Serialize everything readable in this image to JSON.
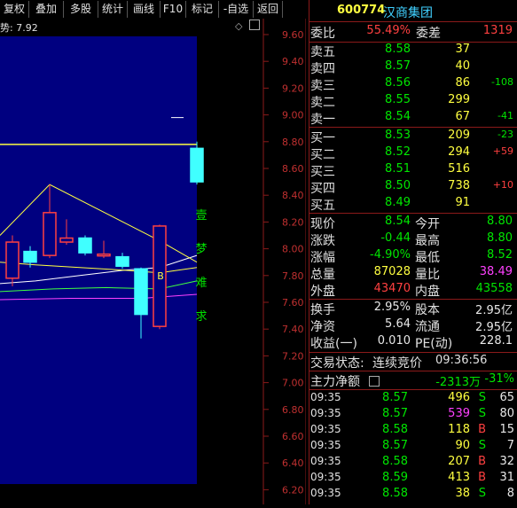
{
  "toolbar": {
    "buttons": [
      "复权",
      "叠加",
      "多股",
      "统计",
      "画线",
      "F10",
      "标记",
      "-自选",
      "返回"
    ]
  },
  "chart": {
    "indicator_text": "势: 7.92",
    "y_ticks": [
      "9.60",
      "9.40",
      "9.20",
      "9.00",
      "8.80",
      "8.60",
      "8.40",
      "8.20",
      "8.00",
      "7.80",
      "7.60",
      "7.40",
      "7.20",
      "7.00",
      "6.80",
      "6.60",
      "6.40",
      "6.20"
    ],
    "vertical_text": [
      "壹",
      "梦",
      "难",
      "求"
    ],
    "b_marker": "B",
    "candles": [
      {
        "open": 7.78,
        "close": 8.05,
        "high": 8.1,
        "low": 7.72,
        "color": "red"
      },
      {
        "open": 7.98,
        "close": 7.9,
        "high": 8.02,
        "low": 7.86,
        "color": "cyan"
      },
      {
        "open": 7.95,
        "close": 8.27,
        "high": 8.48,
        "low": 7.93,
        "color": "red"
      },
      {
        "open": 8.08,
        "close": 8.05,
        "high": 8.22,
        "low": 8.03,
        "color": "red"
      },
      {
        "open": 8.08,
        "close": 7.97,
        "high": 8.1,
        "low": 7.95,
        "color": "cyan"
      },
      {
        "open": 7.96,
        "close": 7.95,
        "high": 8.06,
        "low": 7.93,
        "color": "red"
      },
      {
        "open": 7.94,
        "close": 7.87,
        "high": 7.97,
        "low": 7.85,
        "color": "cyan"
      },
      {
        "open": 7.85,
        "close": 7.51,
        "high": 7.86,
        "low": 7.33,
        "color": "cyan"
      },
      {
        "open": 7.42,
        "close": 8.17,
        "high": 8.18,
        "low": 7.4,
        "color": "red"
      },
      {
        "open": 8.75,
        "close": 8.5,
        "high": 8.8,
        "low": 8.48,
        "color": "cyan"
      }
    ]
  },
  "quote": {
    "code": "600774",
    "name": "汉商集团",
    "weibi_label": "委比",
    "weibi_value": "55.49%",
    "weicha_label": "委差",
    "weicha_value": "1319",
    "sell": [
      {
        "label": "卖五",
        "price": "8.58",
        "vol": "37",
        "chg": ""
      },
      {
        "label": "卖四",
        "price": "8.57",
        "vol": "40",
        "chg": ""
      },
      {
        "label": "卖三",
        "price": "8.56",
        "vol": "86",
        "chg": "-108"
      },
      {
        "label": "卖二",
        "price": "8.55",
        "vol": "299",
        "chg": ""
      },
      {
        "label": "卖一",
        "price": "8.54",
        "vol": "67",
        "chg": "-41"
      }
    ],
    "buy": [
      {
        "label": "买一",
        "price": "8.53",
        "vol": "209",
        "chg": "-23"
      },
      {
        "label": "买二",
        "price": "8.52",
        "vol": "294",
        "chg": "+59"
      },
      {
        "label": "买三",
        "price": "8.51",
        "vol": "516",
        "chg": ""
      },
      {
        "label": "买四",
        "price": "8.50",
        "vol": "738",
        "chg": "+10"
      },
      {
        "label": "买五",
        "price": "8.49",
        "vol": "91",
        "chg": ""
      }
    ],
    "stats": [
      {
        "l1": "现价",
        "v1": "8.54",
        "l2": "今开",
        "v2": "8.80"
      },
      {
        "l1": "涨跌",
        "v1": "-0.44",
        "l2": "最高",
        "v2": "8.80"
      },
      {
        "l1": "涨幅",
        "v1": "-4.90%",
        "l2": "最低",
        "v2": "8.52"
      },
      {
        "l1": "总量",
        "v1": "87028",
        "l2": "量比",
        "v2": "38.49"
      },
      {
        "l1": "外盘",
        "v1": "43470",
        "l2": "内盘",
        "v2": "43558"
      }
    ],
    "stats2": [
      {
        "l1": "换手",
        "v1": "2.95%",
        "l2": "股本",
        "v2": "2.95亿"
      },
      {
        "l1": "净资",
        "v1": "5.64",
        "l2": "流通",
        "v2": "2.95亿"
      },
      {
        "l1": "收益(一)",
        "v1": "0.010",
        "l2": "PE(动)",
        "v2": "228.1"
      }
    ],
    "trade_status_label": "交易状态:",
    "trade_status_value": "连续竞价",
    "trade_status_time": "09:36:56",
    "main_net_label": "主力净额",
    "main_net_value": "-2313万",
    "main_net_pct": "-31%",
    "ticks": [
      {
        "time": "09:35",
        "price": "8.57",
        "vol": "496",
        "bs": "S",
        "n": "65"
      },
      {
        "time": "09:35",
        "price": "8.57",
        "vol": "539",
        "bs": "S",
        "n": "80"
      },
      {
        "time": "09:35",
        "price": "8.58",
        "vol": "118",
        "bs": "B",
        "n": "15"
      },
      {
        "time": "09:35",
        "price": "8.57",
        "vol": "90",
        "bs": "S",
        "n": "7"
      },
      {
        "time": "09:35",
        "price": "8.58",
        "vol": "207",
        "bs": "B",
        "n": "32"
      },
      {
        "time": "09:35",
        "price": "8.59",
        "vol": "413",
        "bs": "B",
        "n": "31"
      },
      {
        "time": "09:35",
        "price": "8.58",
        "vol": "38",
        "bs": "S",
        "n": "8"
      }
    ]
  },
  "colors": {
    "up": "#ff4040",
    "down": "#40ffff",
    "grid_red": "#8b1a1a",
    "panel_blue": "#000080"
  }
}
